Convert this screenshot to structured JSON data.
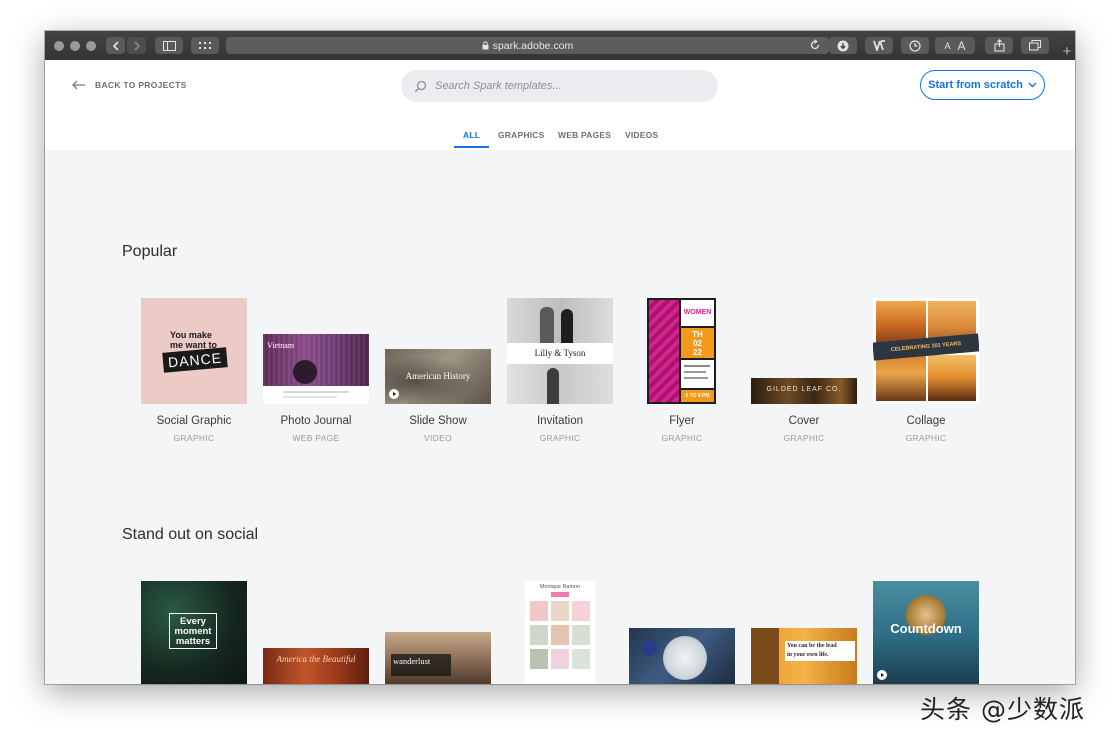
{
  "browser": {
    "url": "spark.adobe.com"
  },
  "header": {
    "back_label": "BACK TO PROJECTS",
    "search_placeholder": "Search Spark templates...",
    "start_button": "Start from scratch"
  },
  "tabs": [
    {
      "label": "ALL",
      "active": true
    },
    {
      "label": "GRAPHICS",
      "active": false
    },
    {
      "label": "WEB PAGES",
      "active": false
    },
    {
      "label": "VIDEOS",
      "active": false
    }
  ],
  "sections": [
    {
      "title": "Popular",
      "cards": [
        {
          "name": "Social Graphic",
          "type": "GRAPHIC",
          "thumb_text": [
            "You make",
            "me want to",
            "DANCE"
          ]
        },
        {
          "name": "Photo Journal",
          "type": "WEB PAGE",
          "thumb_text": [
            "Vietnam"
          ]
        },
        {
          "name": "Slide Show",
          "type": "VIDEO",
          "thumb_text": [
            "American History"
          ]
        },
        {
          "name": "Invitation",
          "type": "GRAPHIC",
          "thumb_text": [
            "Lilly & Tyson"
          ]
        },
        {
          "name": "Flyer",
          "type": "GRAPHIC",
          "thumb_text": [
            "WOMEN",
            "TH",
            "02",
            "22",
            "6 TO 9 PM"
          ]
        },
        {
          "name": "Cover",
          "type": "GRAPHIC",
          "thumb_text": [
            "GILDED LEAF CO."
          ]
        },
        {
          "name": "Collage",
          "type": "GRAPHIC",
          "thumb_text": [
            "CELEBRATING 101 YEARS"
          ]
        }
      ]
    },
    {
      "title": "Stand out on social",
      "cards": [
        {
          "thumb_text": [
            "Every",
            "moment",
            "matters"
          ]
        },
        {
          "thumb_text": [
            "America the Beautiful"
          ]
        },
        {
          "thumb_text": [
            "wanderlust"
          ]
        },
        {
          "thumb_text": [
            "Monique Ramon"
          ]
        },
        {
          "thumb_text": []
        },
        {
          "thumb_text": [
            "You can be the lead",
            "in your own life."
          ]
        },
        {
          "thumb_text": [
            "Countdown"
          ]
        }
      ]
    }
  ],
  "watermark": "头条 @少数派",
  "colors": {
    "accent": "#1473e6",
    "page_bg": "#f4f5f7"
  }
}
